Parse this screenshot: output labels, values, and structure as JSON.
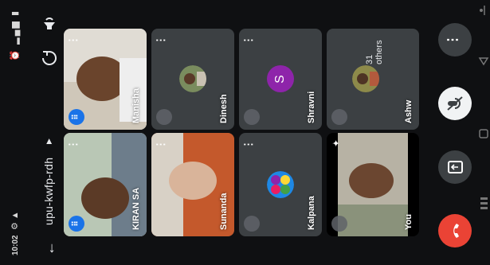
{
  "status_bar": {
    "time": "10:02"
  },
  "header": {
    "meeting_code": "upu-kwfp-rdh"
  },
  "participants": [
    {
      "name": "KIRAN SA"
    },
    {
      "name": "Manisha"
    },
    {
      "name": "Sunanda"
    },
    {
      "name": "Dinesh"
    },
    {
      "name": "Kalpana"
    },
    {
      "name": "Shravni",
      "initial": "S"
    },
    {
      "name": "You"
    },
    {
      "name": "Ashw",
      "extra": "31 others"
    }
  ],
  "colors": {
    "end_call": "#ea4335",
    "presenter_badge": "#1a73e8",
    "avatar_purple": "#8e24aa"
  }
}
